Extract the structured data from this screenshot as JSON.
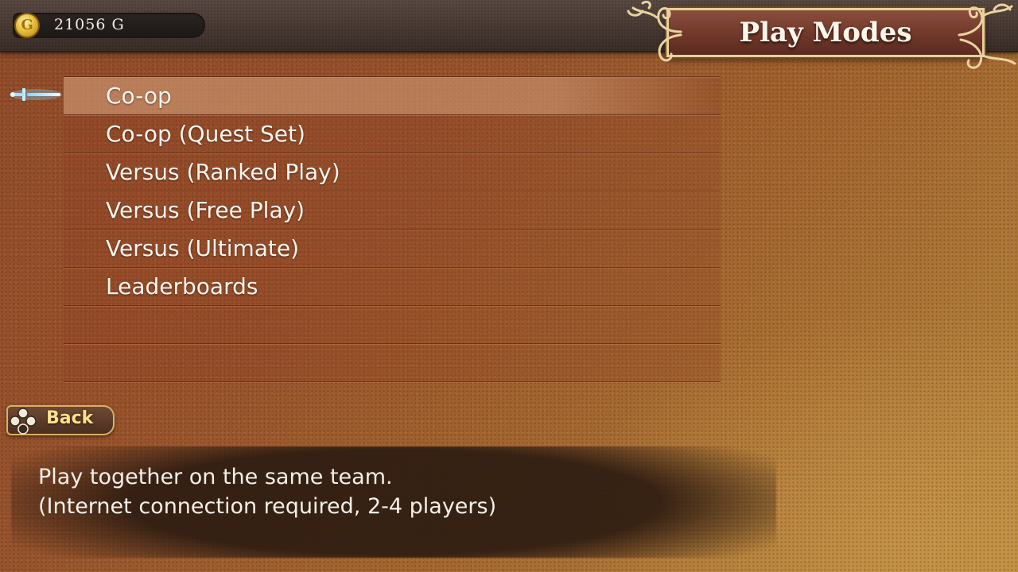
{
  "header": {
    "currency_symbol": "G",
    "gold_amount": "21056  G",
    "title": "Play Modes"
  },
  "menu": {
    "items": [
      {
        "label": "Co-op",
        "selected": true
      },
      {
        "label": "Co-op (Quest Set)",
        "selected": false
      },
      {
        "label": "Versus (Ranked Play)",
        "selected": false
      },
      {
        "label": "Versus (Free Play)",
        "selected": false
      },
      {
        "label": "Versus (Ultimate)",
        "selected": false
      },
      {
        "label": "Leaderboards",
        "selected": false
      }
    ],
    "cursor_icon": "sword-cursor-icon"
  },
  "back_button": {
    "label": "Back",
    "icon": "dpad-button-icon"
  },
  "description": {
    "line1": "Play together on the same team.",
    "line2": "(Internet connection required, 2-4 players)"
  },
  "colors": {
    "title_plate": "#6e3628",
    "gold_trim": "#e9cf9a",
    "back_text": "#ffe08a"
  }
}
